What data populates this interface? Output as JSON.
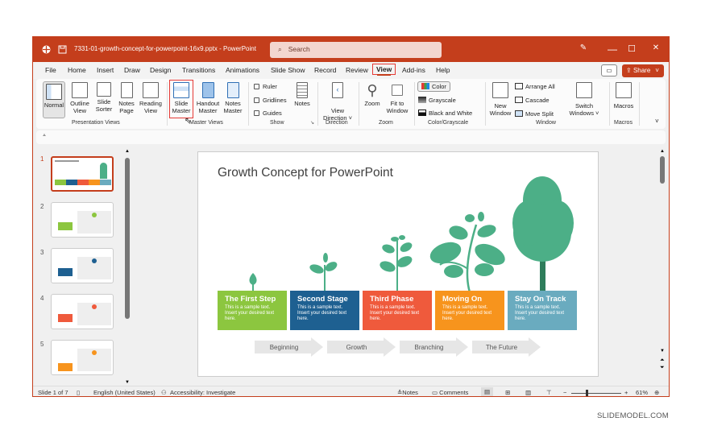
{
  "titlebar": {
    "filename": "7331-01-growth-concept-for-powerpoint-16x9.pptx",
    "separator": "-",
    "app": "PowerPoint",
    "search_placeholder": "Search",
    "minimize": "—",
    "maximize": "☐",
    "close": "✕"
  },
  "menu": {
    "tabs": [
      "File",
      "Home",
      "Insert",
      "Draw",
      "Design",
      "Transitions",
      "Animations",
      "Slide Show",
      "Record",
      "Review",
      "View",
      "Add-ins",
      "Help"
    ],
    "active_tab": "View",
    "share_label": "Share"
  },
  "ribbon": {
    "presentation_views": {
      "label": "Presentation Views",
      "buttons": [
        {
          "line1": "Normal",
          "line2": ""
        },
        {
          "line1": "Outline",
          "line2": "View"
        },
        {
          "line1": "Slide",
          "line2": "Sorter"
        },
        {
          "line1": "Notes",
          "line2": "Page"
        },
        {
          "line1": "Reading",
          "line2": "View"
        }
      ]
    },
    "master_views": {
      "label": "Master Views",
      "buttons": [
        {
          "line1": "Slide",
          "line2": "Master"
        },
        {
          "line1": "Handout",
          "line2": "Master"
        },
        {
          "line1": "Notes",
          "line2": "Master"
        }
      ]
    },
    "show": {
      "label": "Show",
      "checkboxes": [
        {
          "label": "Ruler",
          "checked": false
        },
        {
          "label": "Gridlines",
          "checked": false
        },
        {
          "label": "Guides",
          "checked": false
        }
      ],
      "notes": "Notes"
    },
    "direction": {
      "label": "Direction",
      "button_line1": "View",
      "button_line2": "Direction ˅"
    },
    "zoom": {
      "label": "Zoom",
      "zoom": "Zoom",
      "fit_line1": "Fit to",
      "fit_line2": "Window"
    },
    "color": {
      "label": "Color/Grayscale",
      "items": [
        "Color",
        "Grayscale",
        "Black and White"
      ]
    },
    "window": {
      "label": "Window",
      "new_line1": "New",
      "new_line2": "Window",
      "items": [
        "Arrange All",
        "Cascade",
        "Move Split"
      ],
      "switch_line1": "Switch",
      "switch_line2": "Windows ˅"
    },
    "macros": {
      "label": "Macros",
      "button": "Macros"
    }
  },
  "slides_panel": {
    "numbers": [
      "1",
      "2",
      "3",
      "4",
      "5"
    ],
    "selected": 1
  },
  "slide": {
    "title": "Growth Concept for PowerPoint",
    "stages": [
      {
        "title": "The First Step",
        "text": "This is a sample text. Insert your desired text here.",
        "color": "#8cc63f"
      },
      {
        "title": "Second Stage",
        "text": "This is a sample text. Insert your desired text here.",
        "color": "#1e6091"
      },
      {
        "title": "Third Phase",
        "text": "This is a sample text. Insert your desired text here.",
        "color": "#ef5a3c"
      },
      {
        "title": "Moving On",
        "text": "This is a sample text. Insert your desired text here.",
        "color": "#f7941d"
      },
      {
        "title": "Stay On Track",
        "text": "This is a sample text. Insert your desired text here.",
        "color": "#6aabbf"
      }
    ],
    "arrows": [
      "Beginning",
      "Growth",
      "Branching",
      "The Future"
    ],
    "plant_color": "#4caf87"
  },
  "status": {
    "slide_counter": "Slide 1 of 7",
    "language": "English (United States)",
    "accessibility": "Accessibility: Investigate",
    "notes": "Notes",
    "comments": "Comments",
    "zoom_minus": "−",
    "zoom_plus": "+",
    "zoom_level": "61%"
  },
  "watermark": "SLIDEMODEL.COM"
}
